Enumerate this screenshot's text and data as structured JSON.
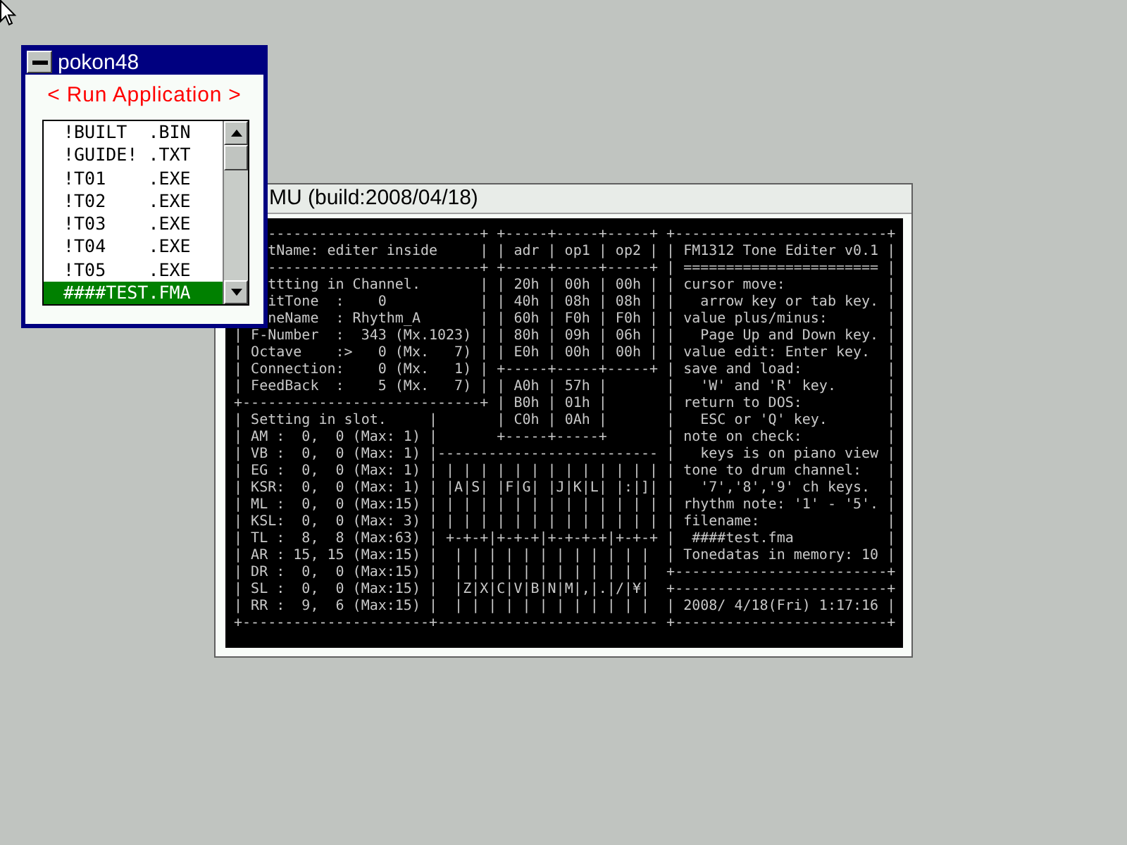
{
  "launcher": {
    "title": "pokon48",
    "heading": "< Run Application >",
    "files": [
      {
        "label": "!BUILT  .BIN",
        "selected": false
      },
      {
        "label": "!GUIDE! .TXT",
        "selected": false
      },
      {
        "label": "!T01    .EXE",
        "selected": false
      },
      {
        "label": "!T02    .EXE",
        "selected": false
      },
      {
        "label": "!T03    .EXE",
        "selected": false
      },
      {
        "label": "!T04    .EXE",
        "selected": false
      },
      {
        "label": "!T05    .EXE",
        "selected": false
      },
      {
        "label": "####TEST.FMA",
        "selected": true
      }
    ]
  },
  "terminal": {
    "title": "MU (build:2008/04/18)",
    "lines": [
      "     -------------------------+ +-----+-----+-----+ +-------------------------+",
      "     tName: editer inside     | | adr | op1 | op2 | | FM1312 Tone Editer v0.1 |",
      "     -------------------------+ +-----+-----+-----+ | ======================= |",
      "     ttting in Channel.       | | 20h | 00h | 00h | | cursor move:            |",
      "     itTone  :    0           | | 40h | 08h | 08h | |   arrow key or tab key. |",
      "     neName  : Rhythm_A       | | 60h | F0h | F0h | | value plus/minus:       |",
      " | F-Number  :  343 (Mx.1023) | | 80h | 09h | 06h | |   Page Up and Down key. |",
      " | Octave    :>   0 (Mx.   7) | | E0h | 00h | 00h | | value edit: Enter key.  |",
      " | Connection:    0 (Mx.   1) | +-----+-----+-----+ | save and load:          |",
      " | FeedBack  :    5 (Mx.   7) | | A0h | 57h |       |   'W' and 'R' key.      |",
      " +----------------------------+ | B0h | 01h |       | return to DOS:          |",
      " | Setting in slot.     |       | C0h | 0Ah |       |   ESC or 'Q' key.       |",
      " | AM :  0,  0 (Max: 1) |       +-----+-----+       | note on check:          |",
      " | VB :  0,  0 (Max: 1) |-------------------------- |   keys is on piano view |",
      " | EG :  0,  0 (Max: 1) | | | | | | | | | | | | | | | tone to drum channel:   |",
      " | KSR:  0,  0 (Max: 1) | |A|S| |F|G| |J|K|L| |:|]| |   '7','8','9' ch keys.  |",
      " | ML :  0,  0 (Max:15) | | | | | | | | | | | | | | | rhythm note: '1' - '5'. |",
      " | KSL:  0,  0 (Max: 3) | | | | | | | | | | | | | | | filename:               |",
      " | TL :  8,  8 (Max:63) | +-+-+|+-+-+|+-+-+-+|+-+-+ |  ####test.fma           |",
      " | AR : 15, 15 (Max:15) |  | | | | | | | | | | | |  | Tonedatas in memory: 10 |",
      " | DR :  0,  0 (Max:15) |  | | | | | | | | | | | |  +-------------------------+",
      " | SL :  0,  0 (Max:15) |  |Z|X|C|V|B|N|M|,|.|/|¥|  +-------------------------+",
      " | RR :  9,  6 (Max:15) |  | | | | | | | | | | | |  | 2008/ 4/18(Fri) 1:17:16 |",
      " +----------------------+-------------------------- +-------------------------+"
    ]
  }
}
